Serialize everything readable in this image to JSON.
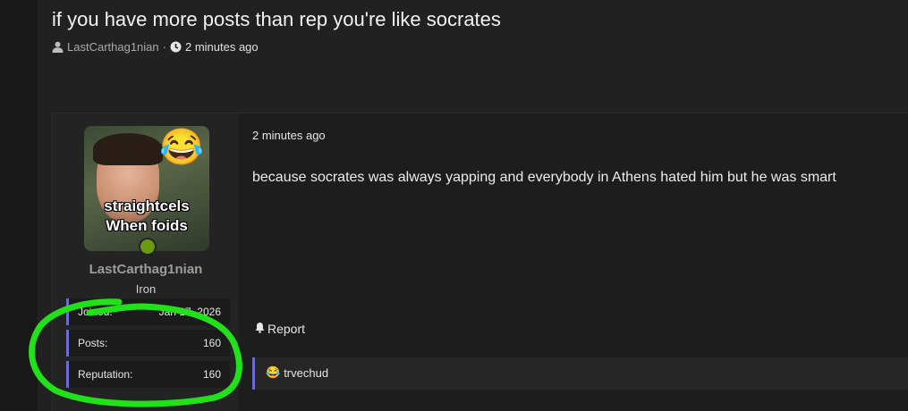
{
  "thread": {
    "title": "if you have more posts than rep you're like socrates",
    "author": "LastCarthag1nian",
    "separator": "·",
    "time": "2 minutes ago"
  },
  "post": {
    "avatar_caption_line1": "straightcels",
    "avatar_caption_line2": "When foids",
    "avatar_emoji": "😂",
    "username": "LastCarthag1nian",
    "rank": "Iron",
    "stats": {
      "joined_label": "Joined:",
      "joined_value": "Jan 17, 2026",
      "posts_label": "Posts:",
      "posts_value": "160",
      "reputation_label": "Reputation:",
      "reputation_value": "160"
    },
    "time": "2 minutes ago",
    "body": "because socrates was always yapping and everybody in Athens hated him but he was smart",
    "report_label": "Report",
    "reaction_emoji": "😂",
    "reaction_user": "trvechud"
  },
  "icons": {
    "user": "user-icon",
    "clock": "clock-icon",
    "bell": "bell-icon"
  },
  "colors": {
    "accent_border": "#6c6cd0",
    "online": "#6a9a12",
    "highlight_scribble": "#22e01a"
  }
}
